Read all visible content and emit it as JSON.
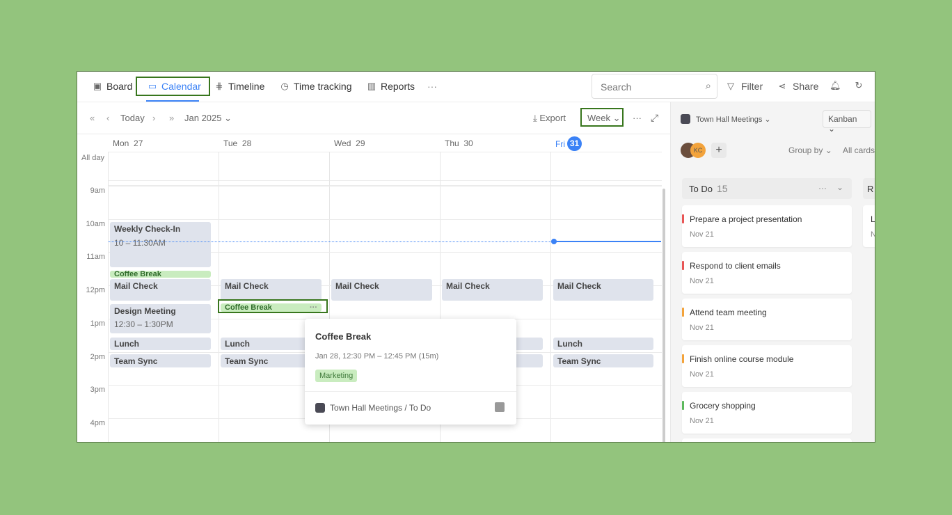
{
  "nav": {
    "tabs": [
      {
        "label": "Board",
        "icon": "board-icon"
      },
      {
        "label": "Calendar",
        "icon": "calendar-icon"
      },
      {
        "label": "Timeline",
        "icon": "timeline-icon"
      },
      {
        "label": "Time tracking",
        "icon": "clock-icon"
      },
      {
        "label": "Reports",
        "icon": "reports-icon"
      }
    ],
    "more": "···",
    "search_placeholder": "Search",
    "filter": "Filter",
    "share": "Share"
  },
  "toolbar": {
    "first": "«",
    "prev": "‹",
    "today": "Today",
    "next": "›",
    "last": "»",
    "month": "Jan 2025",
    "export": "Export",
    "view": "Week",
    "more": "···"
  },
  "days": [
    {
      "name": "Mon",
      "num": "27"
    },
    {
      "name": "Tue",
      "num": "28"
    },
    {
      "name": "Wed",
      "num": "29"
    },
    {
      "name": "Thu",
      "num": "30"
    },
    {
      "name": "Fri",
      "num": "31"
    }
  ],
  "allday": "All day",
  "hours": [
    "9am",
    "10am",
    "11am",
    "12pm",
    "1pm",
    "2pm",
    "3pm",
    "4pm"
  ],
  "events": {
    "weekly": "Weekly Check-In",
    "weekly_time": "10 – 11:30AM",
    "coffee": "Coffee Break",
    "mail": "Mail Check",
    "design": "Design Meeting",
    "design_time": "12:30 – 1:30PM",
    "lunch": "Lunch",
    "sync": "Team Sync",
    "ellipsis": "···"
  },
  "popup": {
    "title": "Coffee Break",
    "time": "Jan 28, 12:30 PM – 12:45 PM (15m)",
    "tag": "Marketing",
    "path": "Town Hall Meetings / To Do"
  },
  "panel": {
    "project": "Town Hall Meetings",
    "view": "Kanban",
    "avatar2": "KC",
    "group_by": "Group by",
    "all_cards": "All cards",
    "column": "To Do",
    "count": "15",
    "column2": "R",
    "cards": [
      {
        "title": "Prepare a project presentation",
        "date": "Nov 21",
        "color": "#e85656"
      },
      {
        "title": "Respond to client emails",
        "date": "Nov 21",
        "color": "#e85656"
      },
      {
        "title": "Attend team meeting",
        "date": "Nov 21",
        "color": "#f3a33b"
      },
      {
        "title": "Finish online course module",
        "date": "Nov 21",
        "color": "#f3a33b"
      },
      {
        "title": "Grocery shopping",
        "date": "Nov 21",
        "color": "#5cb85c"
      }
    ],
    "card2": {
      "title": "La",
      "date": "N"
    }
  },
  "colors": {
    "accent": "#3b82f6",
    "highlight": "#38761d",
    "event": "#dfe3ec",
    "coffee": "#c9ecbf"
  }
}
